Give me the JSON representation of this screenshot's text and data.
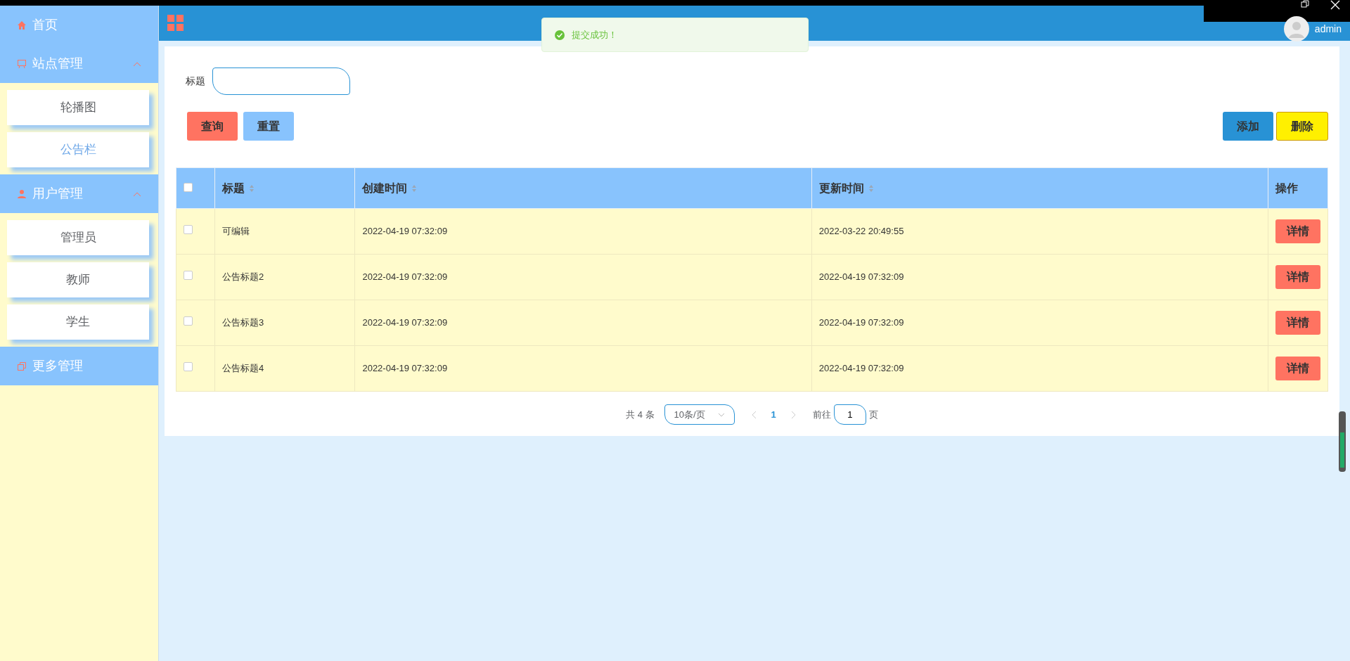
{
  "sidebar": {
    "items": [
      {
        "label": "首页",
        "expanded": false
      },
      {
        "label": "站点管理",
        "expanded": true,
        "children": [
          {
            "label": "轮播图",
            "selected": false
          },
          {
            "label": "公告栏",
            "selected": true
          }
        ]
      },
      {
        "label": "用户管理",
        "expanded": true,
        "children": [
          {
            "label": "管理员",
            "selected": false
          },
          {
            "label": "教师",
            "selected": false
          },
          {
            "label": "学生",
            "selected": false
          }
        ]
      },
      {
        "label": "更多管理",
        "expanded": false
      }
    ]
  },
  "header": {
    "user": "admin"
  },
  "toast": {
    "message": "提交成功！"
  },
  "filter": {
    "label": "标题"
  },
  "buttons": {
    "left": [
      "查询",
      "重置"
    ],
    "right": [
      "添加",
      "删除"
    ]
  },
  "table": {
    "all_checked": false,
    "columns": [
      {
        "label": "标题",
        "sortable": true
      },
      {
        "label": "创建时间",
        "sortable": true
      },
      {
        "label": "更新时间",
        "sortable": true
      },
      {
        "label": "操作",
        "sortable": false
      }
    ],
    "rows": [
      {
        "checked": false,
        "cells": [
          "可编辑",
          "2022-04-19 07:32:09",
          "2022-03-22 20:49:55"
        ],
        "action": "详情"
      },
      {
        "checked": false,
        "cells": [
          "公告标题2",
          "2022-04-19 07:32:09",
          "2022-04-19 07:32:09"
        ],
        "action": "详情"
      },
      {
        "checked": false,
        "cells": [
          "公告标题3",
          "2022-04-19 07:32:09",
          "2022-04-19 07:32:09"
        ],
        "action": "详情"
      },
      {
        "checked": false,
        "cells": [
          "公告标题4",
          "2022-04-19 07:32:09",
          "2022-04-19 07:32:09"
        ],
        "action": "详情"
      }
    ]
  },
  "pagination": {
    "total": "共 4 条",
    "page_size": "10条/页",
    "pages": [
      {
        "label": "1",
        "selected": true
      }
    ],
    "goto_label": "前往",
    "goto_value": "1",
    "goto_suffix": "页"
  }
}
